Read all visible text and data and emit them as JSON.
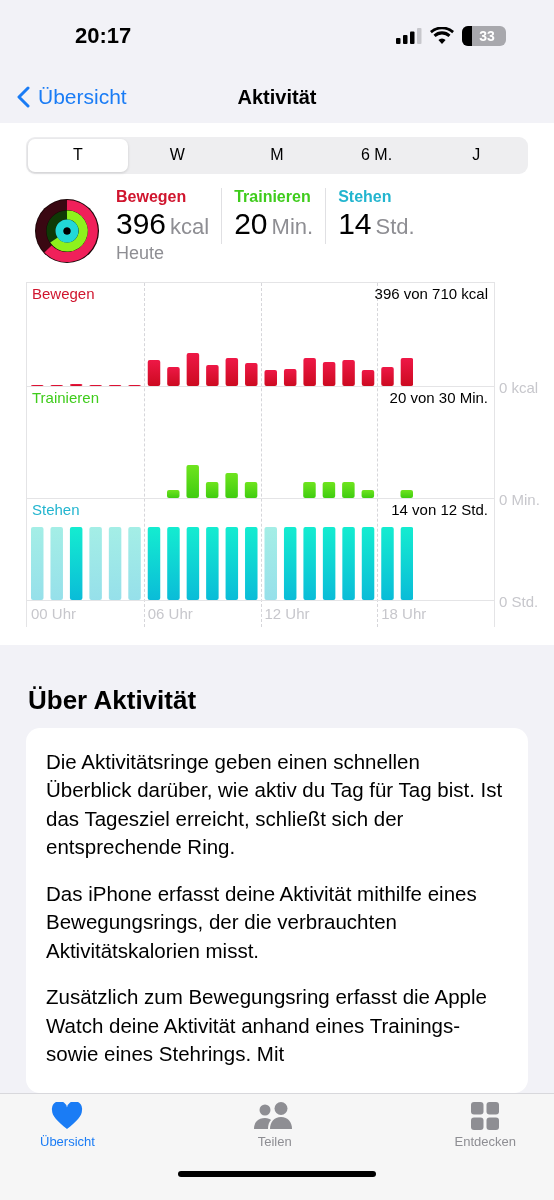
{
  "status_bar": {
    "time": "20:17",
    "battery": "33"
  },
  "nav": {
    "back": "Übersicht",
    "title": "Aktivität"
  },
  "segments": [
    {
      "label": "T",
      "selected": true
    },
    {
      "label": "W",
      "selected": false
    },
    {
      "label": "M",
      "selected": false
    },
    {
      "label": "6 M.",
      "selected": false
    },
    {
      "label": "J",
      "selected": false
    }
  ],
  "summary": {
    "metrics": [
      {
        "label": "Bewegen",
        "value": "396",
        "unit": "kcal",
        "color": "#d0152e"
      },
      {
        "label": "Trainieren",
        "value": "20",
        "unit": "Min.",
        "color": "#3fcc1c"
      },
      {
        "label": "Stehen",
        "value": "14",
        "unit": "Std.",
        "color": "#23b5cf"
      }
    ],
    "period": "Heute"
  },
  "charts": [
    {
      "kind": "move",
      "label": "Bewegen",
      "goal": "396 von 710 kcal",
      "zero": "0 kcal"
    },
    {
      "kind": "exercise",
      "label": "Trainieren",
      "goal": "20 von 30 Min.",
      "zero": "0 Min."
    },
    {
      "kind": "stand",
      "label": "Stehen",
      "goal": "14 von 12 Std.",
      "zero": "0 Std."
    }
  ],
  "x_labels": [
    "00 Uhr",
    "06 Uhr",
    "12 Uhr",
    "18 Uhr"
  ],
  "about": {
    "heading": "Über Aktivität",
    "paragraphs": [
      "Die Aktivitätsringe geben einen schnellen Überblick darüber, wie aktiv du Tag für Tag bist. Ist das Tagesziel erreicht, schließt sich der entsprechende Ring.",
      "Das iPhone erfasst deine Aktivität mithilfe eines Bewegungsrings, der die verbrauchten Aktivitätskalorien misst.",
      "Zusätzlich zum Bewegungsring erfasst die Apple Watch deine Aktivität anhand eines Trainings- sowie eines Stehrings. Mit"
    ]
  },
  "tab_bar": [
    {
      "kind": "heart",
      "label": "Übersicht",
      "selected": true
    },
    {
      "kind": "people",
      "label": "Teilen",
      "selected": false
    },
    {
      "kind": "grid",
      "label": "Entdecken",
      "selected": false
    }
  ]
}
